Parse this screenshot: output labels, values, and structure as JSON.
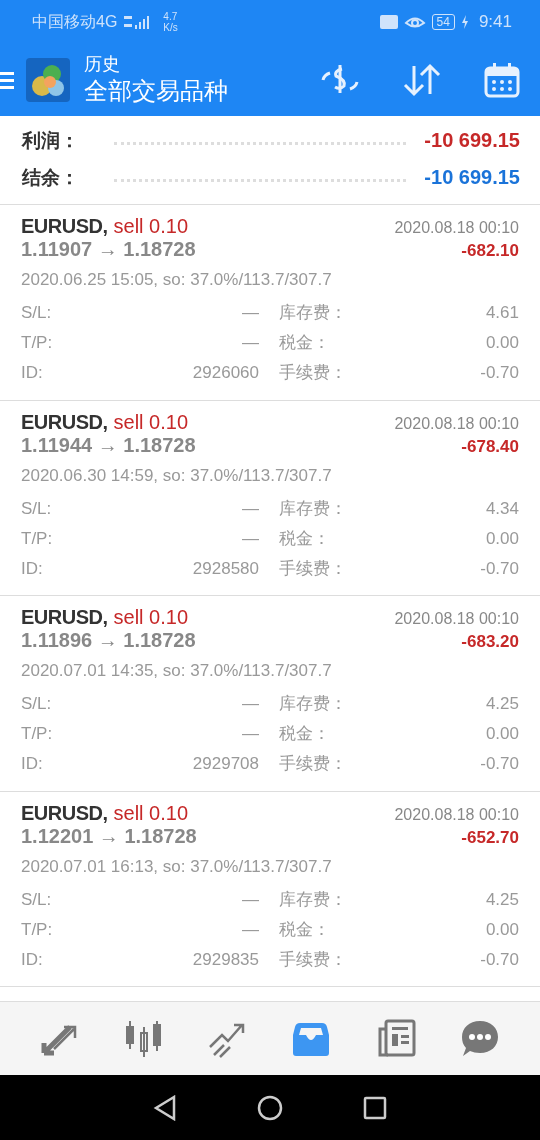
{
  "status_bar": {
    "carrier": "中国移动4G",
    "speed_value": "4.7",
    "speed_unit": "K/s",
    "battery": "54",
    "time": "9:41"
  },
  "header": {
    "title": "历史",
    "subtitle": "全部交易品种"
  },
  "summary": [
    {
      "label": "利润：",
      "value": "-10 699.15",
      "color": "#c62828"
    },
    {
      "label": "结余：",
      "value": "-10 699.15",
      "color": "#1a73d9"
    }
  ],
  "trades": [
    {
      "symbol": "EURUSD,",
      "side": "sell 0.10",
      "prices": "1.11907 → 1.18728",
      "close_time": "2020.08.18 00:10",
      "profit": "-682.10",
      "open_info": "2020.06.25 15:05, so: 37.0%/113.7/307.7",
      "rows": [
        {
          "label": "S/L:",
          "value": "—",
          "label2": "库存费：",
          "value2": "4.61"
        },
        {
          "label": "T/P:",
          "value": "—",
          "label2": "税金：",
          "value2": "0.00"
        },
        {
          "label": "ID:",
          "value": "2926060",
          "label2": "手续费：",
          "value2": "-0.70"
        }
      ]
    },
    {
      "symbol": "EURUSD,",
      "side": "sell 0.10",
      "prices": "1.11944 → 1.18728",
      "close_time": "2020.08.18 00:10",
      "profit": "-678.40",
      "open_info": "2020.06.30 14:59, so: 37.0%/113.7/307.7",
      "rows": [
        {
          "label": "S/L:",
          "value": "—",
          "label2": "库存费：",
          "value2": "4.34"
        },
        {
          "label": "T/P:",
          "value": "—",
          "label2": "税金：",
          "value2": "0.00"
        },
        {
          "label": "ID:",
          "value": "2928580",
          "label2": "手续费：",
          "value2": "-0.70"
        }
      ]
    },
    {
      "symbol": "EURUSD,",
      "side": "sell 0.10",
      "prices": "1.11896 → 1.18728",
      "close_time": "2020.08.18 00:10",
      "profit": "-683.20",
      "open_info": "2020.07.01 14:35, so: 37.0%/113.7/307.7",
      "rows": [
        {
          "label": "S/L:",
          "value": "—",
          "label2": "库存费：",
          "value2": "4.25"
        },
        {
          "label": "T/P:",
          "value": "—",
          "label2": "税金：",
          "value2": "0.00"
        },
        {
          "label": "ID:",
          "value": "2929708",
          "label2": "手续费：",
          "value2": "-0.70"
        }
      ]
    },
    {
      "symbol": "EURUSD,",
      "side": "sell 0.10",
      "prices": "1.12201 → 1.18728",
      "close_time": "2020.08.18 00:10",
      "profit": "-652.70",
      "open_info": "2020.07.01 16:13, so: 37.0%/113.7/307.7",
      "rows": [
        {
          "label": "S/L:",
          "value": "—",
          "label2": "库存费：",
          "value2": "4.25"
        },
        {
          "label": "T/P:",
          "value": "—",
          "label2": "税金：",
          "value2": "0.00"
        },
        {
          "label": "ID:",
          "value": "2929835",
          "label2": "手续费：",
          "value2": "-0.70"
        }
      ]
    }
  ],
  "bottom_nav": [
    {
      "kind": "quotes",
      "selected": false
    },
    {
      "kind": "chart",
      "selected": false
    },
    {
      "kind": "trade",
      "selected": false
    },
    {
      "kind": "history",
      "selected": true
    },
    {
      "kind": "news",
      "selected": false
    },
    {
      "kind": "chat",
      "selected": false
    }
  ]
}
